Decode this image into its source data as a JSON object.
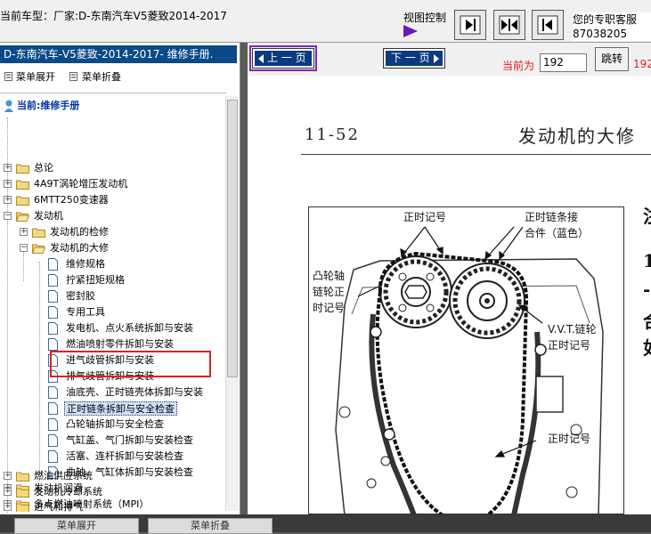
{
  "topbar": {
    "car_title": "当前车型：厂家:D-东南汽车V5菱致2014-2017",
    "view_control_label": "视图控制",
    "service_line1": "您的专职客服",
    "service_line2": "87038205"
  },
  "left_panel": {
    "header": "D-东南汽车-V5菱致-2014-2017- 维修手册.",
    "expand_label": "菜单展开",
    "collapse_label": "菜单折叠",
    "current_label": "当前:维修手册",
    "tree": [
      {
        "label": "总论"
      },
      {
        "label": "4A9T涡轮增压发动机"
      },
      {
        "label": "6MTT250变速器"
      },
      {
        "label": "发动机"
      },
      {
        "label": "发动机的检修"
      },
      {
        "label": "发动机的大修"
      },
      {
        "label": "维修规格"
      },
      {
        "label": "拧紧扭矩规格"
      },
      {
        "label": "密封胶"
      },
      {
        "label": "专用工具"
      },
      {
        "label": "发电机、点火系统拆卸与安装"
      },
      {
        "label": "燃油喷射零件拆卸与安装"
      },
      {
        "label": "进气歧管拆卸与安装"
      },
      {
        "label": "排气歧管拆卸与安装"
      },
      {
        "label": "油底壳、正时链壳体拆卸与安装"
      },
      {
        "label": "正时链条拆卸与安全检查"
      },
      {
        "label": "凸轮轴拆卸与安全检查"
      },
      {
        "label": "气缸盖、气门拆卸与安装检查"
      },
      {
        "label": "活塞、连杆拆卸与安装检查"
      },
      {
        "label": "曲轴、气缸体拆卸与安装检查"
      },
      {
        "label": "发动机润滑"
      },
      {
        "label": "多点燃油喷射系统（MPI）"
      },
      {
        "label": "燃油供应系统"
      },
      {
        "label": "发动机冷却系统"
      },
      {
        "label": "进气和排气"
      }
    ]
  },
  "nav": {
    "prev_label": "上 一 页",
    "next_label": "下 一 页",
    "current_page_label": "当前为",
    "current_page_value": "192",
    "go_label": "跳转",
    "page_value_repeat": "192"
  },
  "page": {
    "page_number": "11-52",
    "title": "发动机的大修",
    "labels": {
      "timing_mark_top": "正时记号",
      "timing_chain_link_l1": "正时链条接",
      "timing_chain_link_l2": "合件（蓝色）",
      "cam_sprocket_l1": "凸轮轴",
      "cam_sprocket_l2": "链轮正",
      "cam_sprocket_l3": "时记号",
      "vvt_l1": "V.V.T.链轮",
      "vvt_l2": "正时记号",
      "timing_mark_bottom": "正时记号"
    },
    "side_text": [
      "注",
      "1",
      "-",
      "合",
      "如"
    ]
  },
  "bottom": {
    "btn1": "菜单展开",
    "btn2": "菜单折叠"
  },
  "colors": {
    "header_blue": "#0a4a88",
    "nav_button_blue": "#0a3a80",
    "highlight_red": "#e02020",
    "prev_outline_purple": "#7a2ab5"
  }
}
